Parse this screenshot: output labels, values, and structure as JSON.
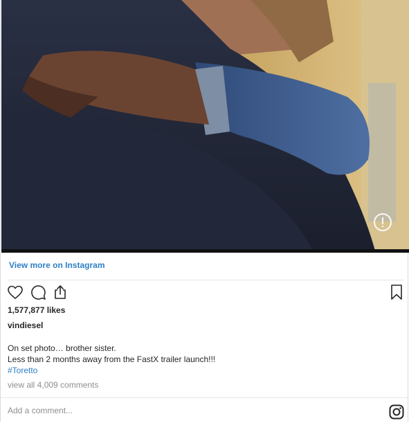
{
  "post": {
    "view_more_label": "View more on Instagram",
    "likes": "1,577,877 likes",
    "username": "vindiesel",
    "caption_lines": [
      "On set photo… brother sister.",
      "Less than 2 months away from the FastX trailer launch!!!"
    ],
    "hashtag": "#Toretto",
    "view_comments": "view all 4,009 comments"
  },
  "comment": {
    "placeholder": "Add a comment..."
  },
  "icons": {
    "like": "heart-icon",
    "comment": "comment-bubble-icon",
    "share": "share-icon",
    "save": "bookmark-icon",
    "instagram": "instagram-logo-icon",
    "info": "info-icon"
  },
  "colors": {
    "link": "#2e7fc7",
    "text": "#262626",
    "muted": "#8e8e8e",
    "divider": "#e6e6e6"
  }
}
